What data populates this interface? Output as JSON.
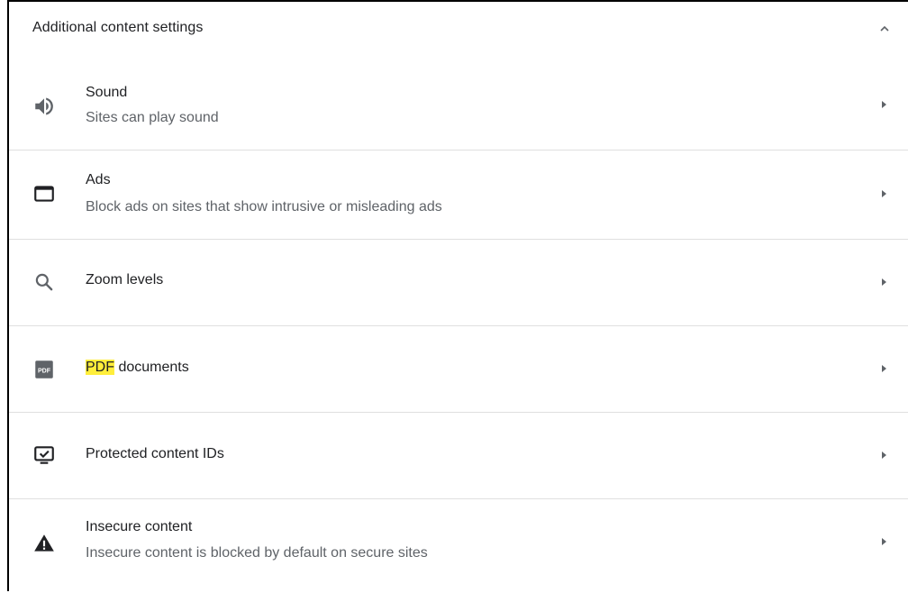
{
  "section": {
    "title": "Additional content settings",
    "expanded_icon": "chevron-up-icon"
  },
  "items": [
    {
      "icon": "speaker-icon",
      "title": "Sound",
      "subtitle": "Sites can play sound",
      "arrow": "arrow-right-icon"
    },
    {
      "icon": "ads-window-icon",
      "title": "Ads",
      "subtitle": "Block ads on sites that show intrusive or misleading ads",
      "arrow": "arrow-right-icon"
    },
    {
      "icon": "zoom-search-icon",
      "title": "Zoom levels",
      "arrow": "arrow-right-icon"
    },
    {
      "icon": "pdf-icon",
      "title_highlight": "PDF",
      "title_rest": " documents",
      "icon_label": "PDF",
      "arrow": "arrow-right-icon"
    },
    {
      "icon": "protected-content-icon",
      "title": "Protected content IDs",
      "arrow": "arrow-right-icon"
    },
    {
      "icon": "warning-icon",
      "title": "Insecure content",
      "subtitle": "Insecure content is blocked by default on secure sites",
      "arrow": "arrow-right-icon"
    }
  ],
  "colors": {
    "text_primary": "#202124",
    "text_secondary": "#5f6368",
    "divider": "#e0e0e0",
    "highlight": "#ffee3b",
    "icon": "#5f6368"
  }
}
